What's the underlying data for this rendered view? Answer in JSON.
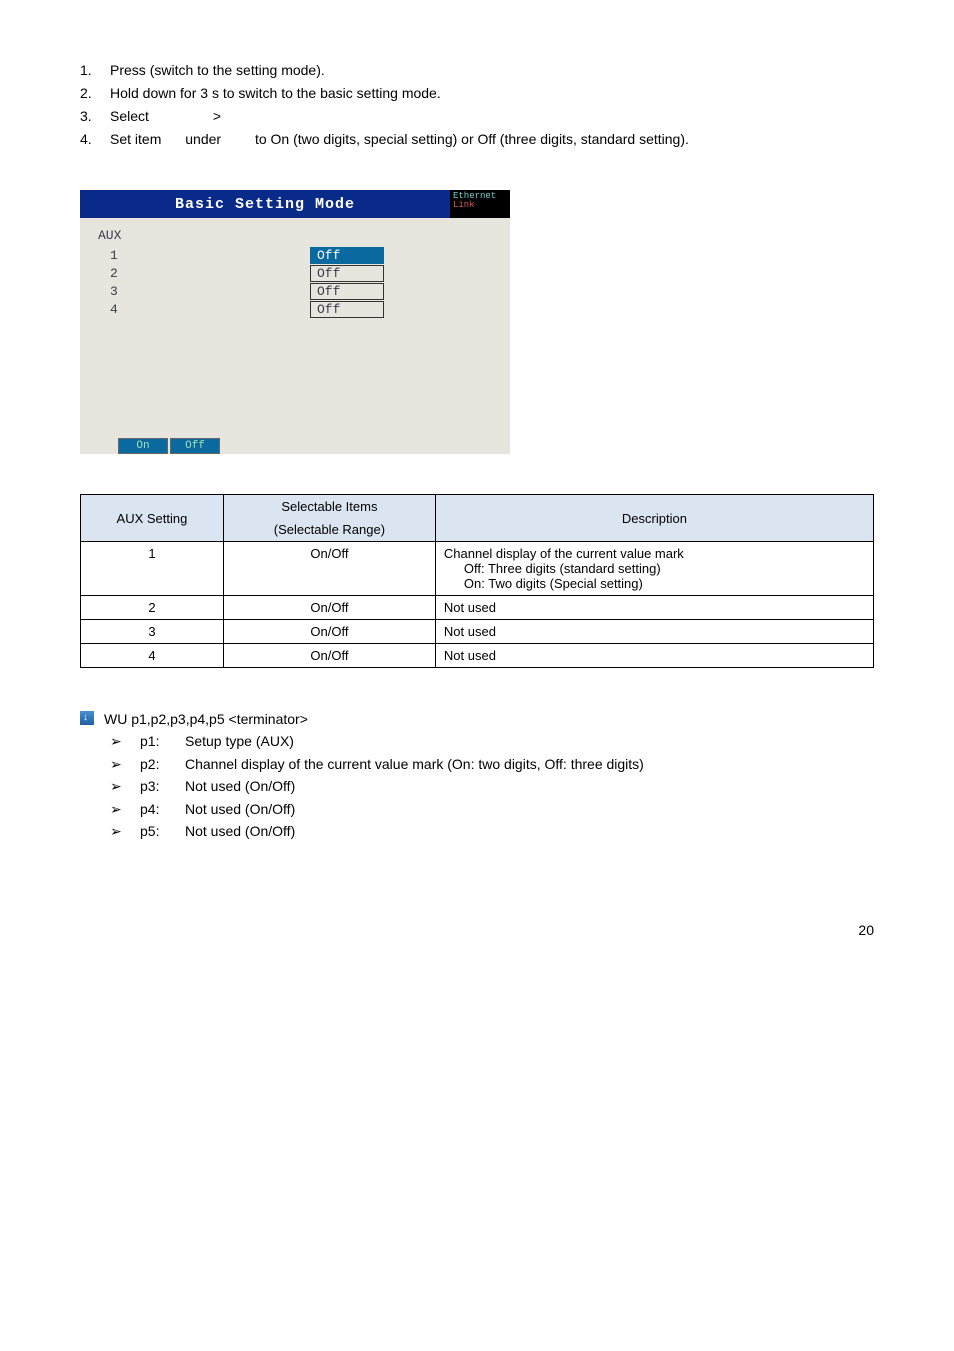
{
  "steps": [
    {
      "num": "1.",
      "parts": [
        "Press ",
        "",
        " (switch to the setting mode)."
      ]
    },
    {
      "num": "2.",
      "parts": [
        "Hold down ",
        "",
        " for 3 s to switch to the basic setting mode."
      ]
    },
    {
      "num": "3.",
      "parts": [
        "Select ",
        "",
        " > ",
        ""
      ]
    },
    {
      "num": "4.",
      "parts": [
        "Set item ",
        "",
        " under ",
        "",
        " to On (two digits, special setting) or Off (three digits, standard setting)."
      ]
    }
  ],
  "screenshot": {
    "title": "Basic Setting Mode",
    "ether": "Ethernet",
    "link": "Link",
    "aux_label": "AUX",
    "rows": [
      {
        "num": "1",
        "val": "Off",
        "selected": true
      },
      {
        "num": "2",
        "val": "Off",
        "selected": false
      },
      {
        "num": "3",
        "val": "Off",
        "selected": false
      },
      {
        "num": "4",
        "val": "Off",
        "selected": false
      }
    ],
    "footer": [
      "On",
      "Off"
    ]
  },
  "table": {
    "headers": [
      "AUX Setting",
      "Selectable Items",
      "Description"
    ],
    "sub_header": "(Selectable Range)",
    "rows": [
      {
        "aux": "1",
        "sel": "On/Off",
        "desc": [
          "Channel display of the current value mark",
          "Off:    Three digits (standard setting)",
          "On:    Two digits (Special setting)"
        ]
      },
      {
        "aux": "2",
        "sel": "On/Off",
        "desc": [
          "Not used"
        ]
      },
      {
        "aux": "3",
        "sel": "On/Off",
        "desc": [
          "Not used"
        ]
      },
      {
        "aux": "4",
        "sel": "On/Off",
        "desc": [
          "Not used"
        ]
      }
    ]
  },
  "commands": {
    "main": "WU p1,p2,p3,p4,p5 <terminator>",
    "params": [
      {
        "name": "p1:",
        "desc": "Setup type (AUX)"
      },
      {
        "name": "p2:",
        "desc": "Channel display of the current value mark (On: two digits, Off: three digits)"
      },
      {
        "name": "p3:",
        "desc": "Not used (On/Off)"
      },
      {
        "name": "p4:",
        "desc": "Not used (On/Off)"
      },
      {
        "name": "p5:",
        "desc": "Not used (On/Off)"
      }
    ]
  },
  "page_number": "20"
}
